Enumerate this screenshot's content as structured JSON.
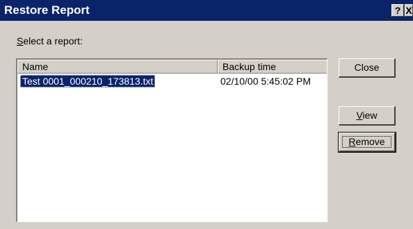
{
  "window": {
    "title": "Restore Report",
    "help_glyph": "?",
    "close_glyph": "X"
  },
  "prompt": {
    "accel": "S",
    "rest": "elect a report:"
  },
  "list": {
    "columns": [
      "Name",
      "Backup time"
    ],
    "rows": [
      {
        "name": "Test 0001_000210_173813.txt",
        "backup_time": "02/10/00 5:45:02 PM",
        "selected": true
      }
    ]
  },
  "buttons": {
    "close_label": "Close",
    "view_accel": "V",
    "view_rest": "iew",
    "remove_accel": "R",
    "remove_rest": "emove"
  },
  "colors": {
    "face": "#d4d0c8",
    "titlebar": "#0a246a",
    "selection": "#0a246a"
  }
}
